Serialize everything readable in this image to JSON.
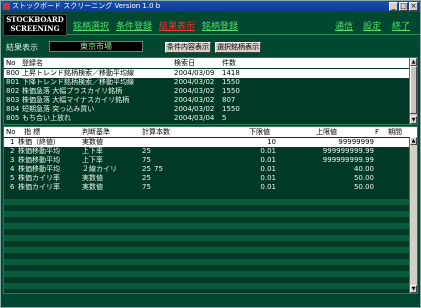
{
  "window": {
    "title": "ストックボード スクリーニング Version 1.0 b"
  },
  "logo": {
    "line1": "STOCKBOARD",
    "line2": "SCREENING"
  },
  "menu": {
    "brand_select": "銘柄選択",
    "condition_register": "条件登録",
    "result_view": "結果表示",
    "brand_register": "銘柄登録",
    "communication": "通信",
    "settings": "設定",
    "exit": "終了"
  },
  "result_bar": {
    "label": "結果表示",
    "market": "東京市場",
    "show_conditions_button": "条件内容表示",
    "show_selected_brands_button": "選択銘柄表示"
  },
  "top_table": {
    "headers": [
      "No",
      "登録名",
      "検索日",
      "件数"
    ],
    "rows": [
      {
        "no": "800",
        "name": "上昇トレンド銘柄検索／移動平均線",
        "date": "2004/03/09",
        "count": "1418",
        "selected": true
      },
      {
        "no": "801",
        "name": "下降トレンド銘柄検索／移動平均線",
        "date": "2004/03/02",
        "count": "1550"
      },
      {
        "no": "802",
        "name": "株価急落  大幅プラスカイリ銘柄",
        "date": "2004/03/02",
        "count": "1550"
      },
      {
        "no": "803",
        "name": "株価急落  大幅マイナスカイリ銘柄",
        "date": "2004/03/02",
        "count": "807"
      },
      {
        "no": "804",
        "name": "短期急落  突っ込み買い",
        "date": "2004/03/02",
        "count": "1550"
      },
      {
        "no": "805",
        "name": "もち合い上放れ",
        "date": "2004/03/04",
        "count": "5"
      }
    ]
  },
  "bottom_table": {
    "headers": [
      "No",
      "指 標",
      "判断基準",
      "計算本数",
      "下限値",
      "上限値",
      "F",
      "期間"
    ],
    "rows": [
      {
        "no": "1",
        "indicator": "株価（終値）",
        "criterion": "実数値",
        "calc1": "",
        "calc2": "",
        "lower": "10",
        "upper": "99999999",
        "f": "",
        "period": "",
        "selected": true
      },
      {
        "no": "2",
        "indicator": "株価移動平均",
        "criterion": "上下率",
        "calc1": "25",
        "calc2": "",
        "lower": "0.01",
        "upper": "999999999.99",
        "f": "",
        "period": ""
      },
      {
        "no": "3",
        "indicator": "株価移動平均",
        "criterion": "上下率",
        "calc1": "75",
        "calc2": "",
        "lower": "0.01",
        "upper": "999999999.99",
        "f": "",
        "period": ""
      },
      {
        "no": "4",
        "indicator": "株価移動平均",
        "criterion": "２線カイリ",
        "calc1": "25",
        "calc2": "75",
        "lower": "0.01",
        "upper": "40.00",
        "f": "",
        "period": ""
      },
      {
        "no": "5",
        "indicator": "株価カイリ率",
        "criterion": "実数値",
        "calc1": "25",
        "calc2": "",
        "lower": "0.01",
        "upper": "50.00",
        "f": "",
        "period": ""
      },
      {
        "no": "6",
        "indicator": "株価カイリ率",
        "criterion": "実数値",
        "calc1": "75",
        "calc2": "",
        "lower": "0.01",
        "upper": "50.00",
        "f": "",
        "period": ""
      }
    ]
  },
  "colors": {
    "background": "#004830",
    "menu": "#4ee06a",
    "menu_active": "#ff3030",
    "title_bar": "#0c3b94"
  }
}
